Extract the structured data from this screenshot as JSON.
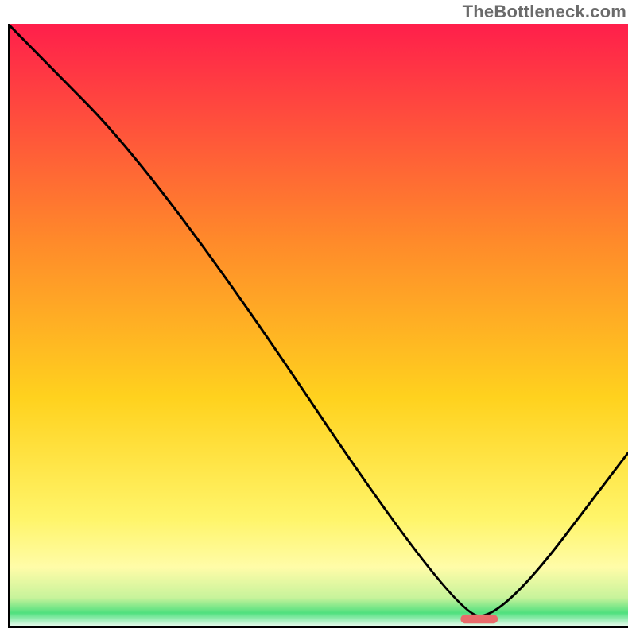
{
  "watermark": "TheBottleneck.com",
  "chart_data": {
    "type": "line",
    "title": "",
    "xlabel": "",
    "ylabel": "",
    "xlim": [
      0,
      100
    ],
    "ylim": [
      0,
      100
    ],
    "grid": false,
    "x": [
      0,
      25,
      72,
      80,
      100
    ],
    "values": [
      100,
      74,
      2,
      2,
      29
    ],
    "curve_color": "#000000",
    "marker": {
      "x": 76,
      "y": 1.5,
      "width": 6,
      "height": 1.5,
      "color": "#e86b6b"
    },
    "background_gradient": {
      "type": "vertical",
      "stops": [
        {
          "offset": 0.0,
          "color": "#ff1f4b"
        },
        {
          "offset": 0.36,
          "color": "#ff8a2a"
        },
        {
          "offset": 0.62,
          "color": "#ffd21e"
        },
        {
          "offset": 0.82,
          "color": "#fff56a"
        },
        {
          "offset": 0.9,
          "color": "#fffca8"
        },
        {
          "offset": 0.95,
          "color": "#c7f39b"
        },
        {
          "offset": 0.975,
          "color": "#4fe07e"
        },
        {
          "offset": 1.0,
          "color": "#ffffff"
        }
      ]
    }
  }
}
